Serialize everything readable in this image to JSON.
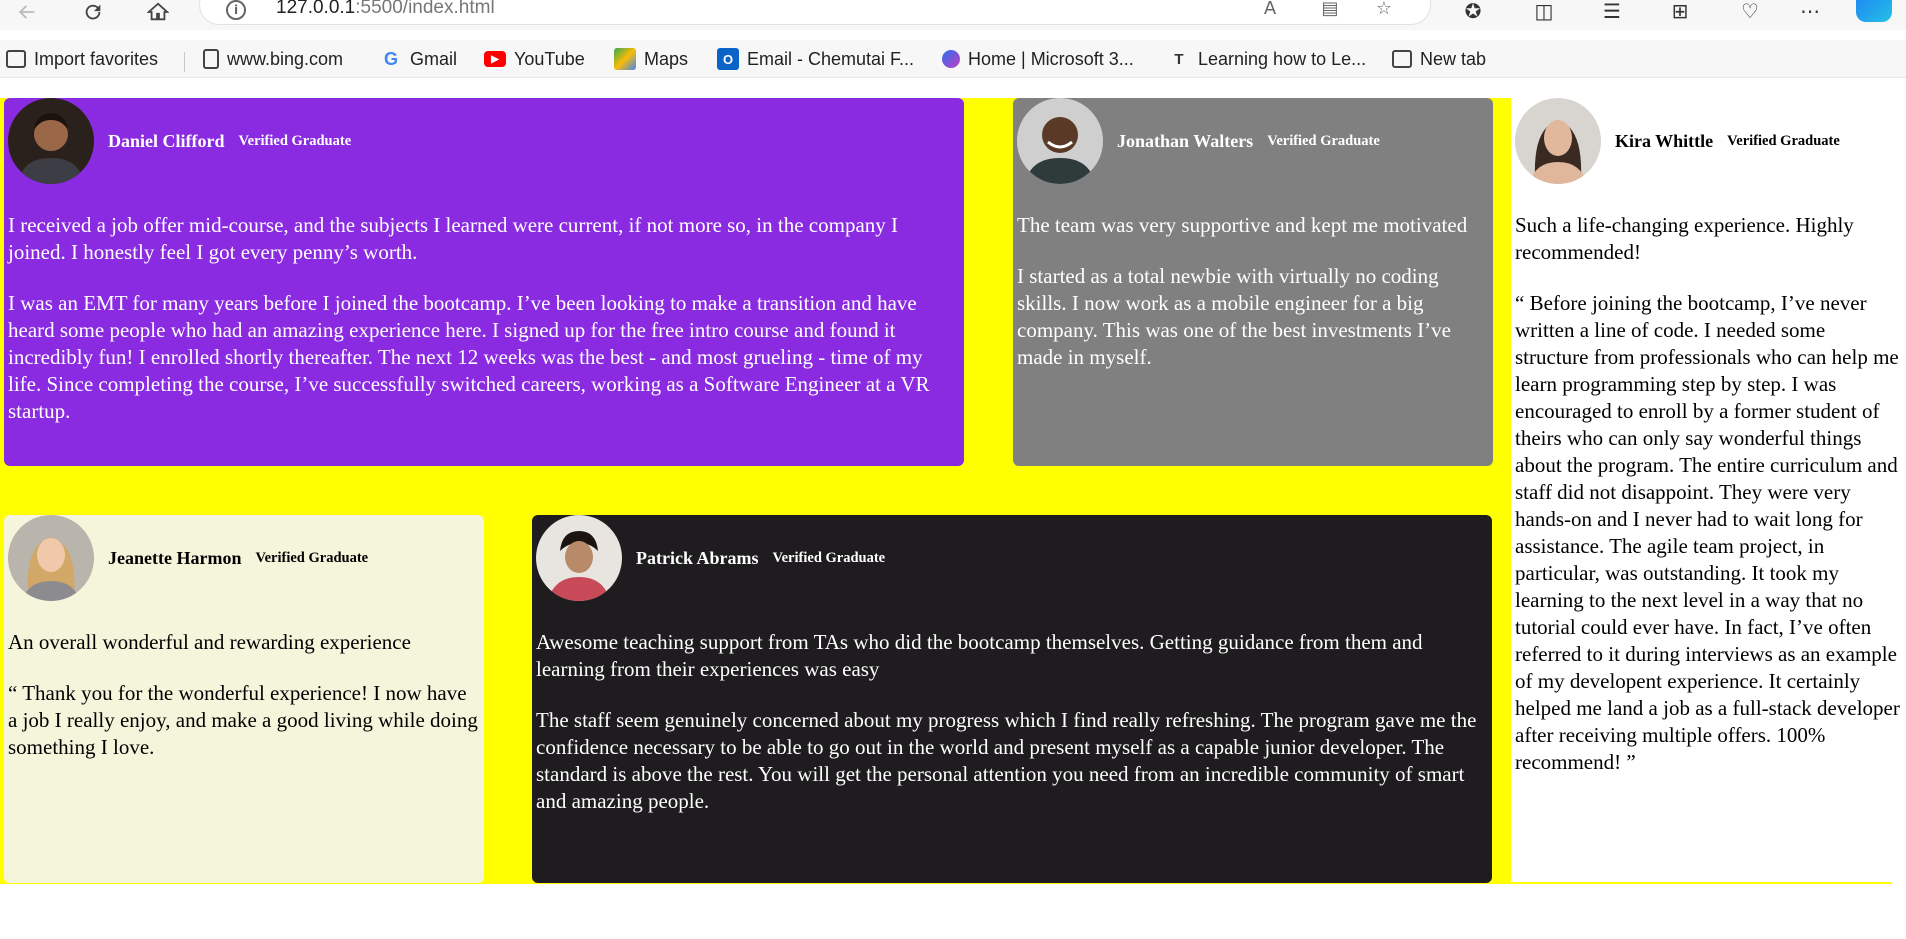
{
  "browser": {
    "url_host": "127.0.0.1",
    "url_path": ":5500/index.html",
    "favorites": [
      {
        "label": "Import favorites",
        "icon": "import-icon"
      },
      {
        "label": "www.bing.com",
        "icon": "page-icon"
      },
      {
        "label": "Gmail",
        "icon": "google-icon"
      },
      {
        "label": "YouTube",
        "icon": "youtube-icon"
      },
      {
        "label": "Maps",
        "icon": "maps-icon"
      },
      {
        "label": "Email - Chemutai F...",
        "icon": "outlook-icon"
      },
      {
        "label": "Home | Microsoft 3...",
        "icon": "microsoft365-icon"
      },
      {
        "label": "Learning how to Le...",
        "icon": "t-icon"
      },
      {
        "label": "New tab",
        "icon": "new-tab-icon"
      }
    ]
  },
  "page_colors": {
    "background": "#ffff00",
    "daniel": "#8a2be2",
    "jonathan": "#808080",
    "kira": "#ffffff",
    "jeanette": "#f5f5dc",
    "patrick": "#1e1c1e"
  },
  "testimonials": {
    "daniel": {
      "name": "Daniel Clifford",
      "badge": "Verified Graduate",
      "headline": "I received a job offer mid-course, and the subjects I learned were current, if not more so, in the company I joined. I honestly feel I got every penny’s worth.",
      "quote": "I was an EMT for many years before I joined the bootcamp. I’ve been looking to make a transition and have heard some people who had an amazing experience here. I signed up for the free intro course and found it incredibly fun! I enrolled shortly thereafter. The next 12 weeks was the best - and most grueling - time of my life. Since completing the course, I’ve successfully switched careers, working as a Software Engineer at a VR startup."
    },
    "jonathan": {
      "name": "Jonathan Walters",
      "badge": "Verified Graduate",
      "headline": "The team was very supportive and kept me motivated",
      "quote": "I started as a total newbie with virtually no coding skills. I now work as a mobile engineer for a big company. This was one of the best investments I’ve made in myself."
    },
    "kira": {
      "name": "Kira Whittle",
      "badge": "Verified Graduate",
      "headline": "Such a life-changing experience. Highly recommended!",
      "quote": "“ Before joining the bootcamp, I’ve never written a line of code. I needed some structure from professionals who can help me learn programming step by step. I was encouraged to enroll by a former student of theirs who can only say wonderful things about the program. The entire curriculum and staff did not disappoint. They were very hands-on and I never had to wait long for assistance. The agile team project, in particular, was outstanding. It took my learning to the next level in a way that no tutorial could ever have. In fact, I’ve often referred to it during interviews as an example of my developent experience. It certainly helped me land a job as a full-stack developer after receiving multiple offers. 100% recommend! ”"
    },
    "jeanette": {
      "name": "Jeanette Harmon",
      "badge": "Verified Graduate",
      "headline": "An overall wonderful and rewarding experience",
      "quote": "“ Thank you for the wonderful experience! I now have a job I really enjoy, and make a good living while doing something I love."
    },
    "patrick": {
      "name": "Patrick Abrams",
      "badge": "Verified Graduate",
      "headline": "Awesome teaching support from TAs who did the bootcamp themselves. Getting guidance from them and learning from their experiences was easy",
      "quote": "The staff seem genuinely concerned about my progress which I find really refreshing. The program gave me the confidence necessary to be able to go out in the world and present myself as a capable junior developer. The standard is above the rest. You will get the personal attention you need from an incredible community of smart and amazing people."
    }
  }
}
